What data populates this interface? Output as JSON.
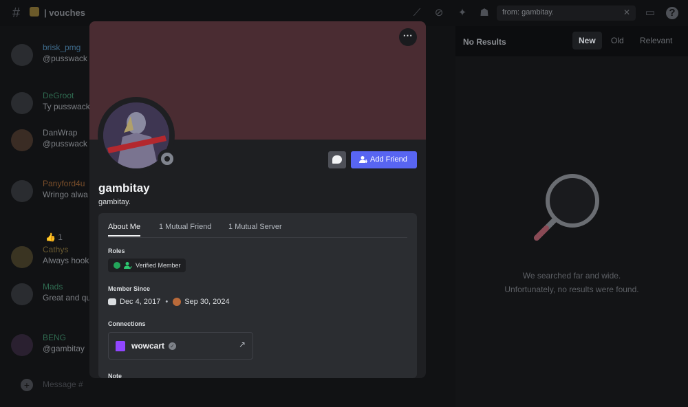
{
  "channel": {
    "name": "vouches"
  },
  "search": {
    "query": "from: gambitay."
  },
  "chat": {
    "messages": [
      {
        "author": "brisk_pmg",
        "author_color": "#3e6a8a",
        "text": "@pusswack"
      },
      {
        "author": "DeGroot",
        "author_color": "#2f6a50",
        "text": "Ty pusswack"
      },
      {
        "author": "DanWrap",
        "author_color": "#7c7f84",
        "text": "@pusswack"
      },
      {
        "author": "Panyford4u",
        "author_color": "#7a4e2a",
        "text": "Wringo alwa"
      },
      {
        "author": "Cathys",
        "author_color": "#6a5a30",
        "text": "Always hook"
      },
      {
        "author": "Mads",
        "author_color": "#2f6a50",
        "text": "Great and qu"
      },
      {
        "author": "BENG",
        "author_color": "#2f6a50",
        "text": "@gambitay"
      }
    ],
    "reaction_count": "1",
    "composer_placeholder": "Message #"
  },
  "results": {
    "status": "No Results",
    "sort_tabs": [
      "New",
      "Old",
      "Relevant"
    ],
    "active_sort": "New",
    "empty_line1": "We searched far and wide.",
    "empty_line2": "Unfortunately, no results were found."
  },
  "profile": {
    "display_name": "gambitay",
    "username": "gambitay.",
    "add_friend_label": "Add Friend",
    "banner_color": "#4a2c32",
    "tabs": [
      "About Me",
      "1 Mutual Friend",
      "1 Mutual Server"
    ],
    "active_tab": "About Me",
    "roles_title": "Roles",
    "role": "Verified Member",
    "member_since_title": "Member Since",
    "discord_since": "Dec 4, 2017",
    "server_since": "Sep 30, 2024",
    "connections_title": "Connections",
    "connection_name": "wowcart",
    "note_title": "Note"
  },
  "colors": {
    "accent": "#5865f2",
    "online_green": "#23a55a",
    "twitch": "#9146ff"
  }
}
